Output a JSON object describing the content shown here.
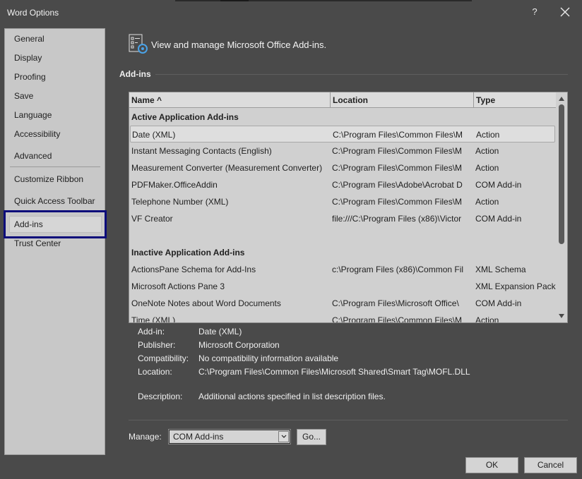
{
  "window": {
    "title": "Word Options",
    "help_label": "?"
  },
  "sidebar": {
    "items": [
      {
        "label": "General"
      },
      {
        "label": "Display"
      },
      {
        "label": "Proofing"
      },
      {
        "label": "Save"
      },
      {
        "label": "Language"
      },
      {
        "label": "Accessibility"
      },
      {
        "label": "Advanced"
      },
      {
        "label": "Customize Ribbon"
      },
      {
        "label": "Quick Access Toolbar"
      },
      {
        "label": "Add-ins"
      },
      {
        "label": "Trust Center"
      }
    ],
    "selected": "Add-ins"
  },
  "header": {
    "text": "View and manage Microsoft Office Add-ins.",
    "section_title": "Add-ins"
  },
  "list": {
    "columns": [
      "Name ^",
      "Location",
      "Type"
    ],
    "active_group": "Active Application Add-ins",
    "active_rows": [
      {
        "name": "Date (XML)",
        "location": "C:\\Program Files\\Common Files\\M",
        "type": "Action"
      },
      {
        "name": "Instant Messaging Contacts (English)",
        "location": "C:\\Program Files\\Common Files\\M",
        "type": "Action"
      },
      {
        "name": "Measurement Converter (Measurement Converter)",
        "location": "C:\\Program Files\\Common Files\\M",
        "type": "Action"
      },
      {
        "name": "PDFMaker.OfficeAddin",
        "location": "C:\\Program Files\\Adobe\\Acrobat D",
        "type": "COM Add-in"
      },
      {
        "name": "Telephone Number (XML)",
        "location": "C:\\Program Files\\Common Files\\M",
        "type": "Action"
      },
      {
        "name": "VF Creator",
        "location": "file:///C:\\Program Files (x86)\\Victor",
        "type": "COM Add-in"
      }
    ],
    "inactive_group": "Inactive Application Add-ins",
    "inactive_rows": [
      {
        "name": "ActionsPane Schema for Add-Ins",
        "location": "c:\\Program Files (x86)\\Common Fil",
        "type": "XML Schema"
      },
      {
        "name": "Microsoft Actions Pane 3",
        "location": "",
        "type": "XML Expansion Pack"
      },
      {
        "name": "OneNote Notes about Word Documents",
        "location": "C:\\Program Files\\Microsoft Office\\",
        "type": "COM Add-in"
      },
      {
        "name": "Time (XML)",
        "location": "C:\\Program Files\\Common Files\\M",
        "type": "Action"
      }
    ],
    "selected_row": "Date (XML)"
  },
  "details": {
    "addin_label": "Add-in:",
    "addin_value": "Date (XML)",
    "publisher_label": "Publisher:",
    "publisher_value": "Microsoft Corporation",
    "compat_label": "Compatibility:",
    "compat_value": "No compatibility information available",
    "location_label": "Location:",
    "location_value": "C:\\Program Files\\Common Files\\Microsoft Shared\\Smart Tag\\MOFL.DLL",
    "description_label": "Description:",
    "description_value": "Additional actions specified in list description files."
  },
  "manage": {
    "label": "Manage:",
    "selected_value": "COM Add-ins",
    "go_label": "Go..."
  },
  "buttons": {
    "ok": "OK",
    "cancel": "Cancel"
  }
}
